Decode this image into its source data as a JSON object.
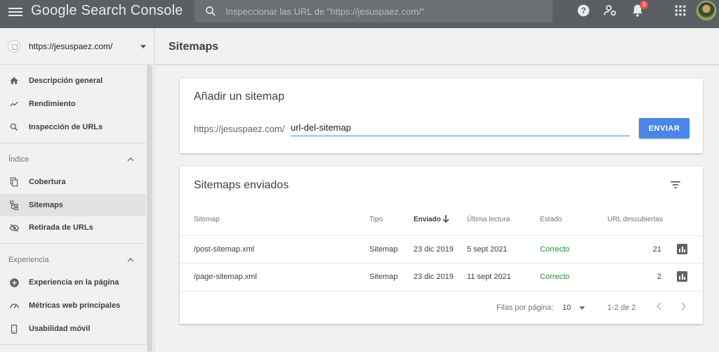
{
  "header": {
    "app_title": "Google Search Console",
    "search_placeholder": "Inspeccionar las URL de \"https://jesuspaez.com/\"",
    "notification_count": "3",
    "icons": [
      "menu-icon",
      "search-icon",
      "help-icon",
      "manage-users-icon",
      "bell-icon",
      "apps-grid-icon",
      "avatar"
    ]
  },
  "sidebar": {
    "property": "https://jesuspaez.com/",
    "nav_top": [
      {
        "label": "Descripción general",
        "icon": "home-icon"
      },
      {
        "label": "Rendimiento",
        "icon": "trending-up-icon"
      },
      {
        "label": "Inspección de URLs",
        "icon": "search-icon"
      }
    ],
    "section_index": {
      "title": "Índice",
      "items": [
        {
          "label": "Cobertura",
          "icon": "copy-pages-icon"
        },
        {
          "label": "Sitemaps",
          "icon": "sitemap-icon",
          "active": true
        },
        {
          "label": "Retirada de URLs",
          "icon": "eye-off-icon"
        }
      ]
    },
    "section_experience": {
      "title": "Experiencia",
      "items": [
        {
          "label": "Experiencia en la página",
          "icon": "plus-circle-icon"
        },
        {
          "label": "Métricas web principales",
          "icon": "speedometer-icon"
        },
        {
          "label": "Usabilidad móvil",
          "icon": "phone-icon"
        }
      ]
    }
  },
  "main": {
    "page_title": "Sitemaps",
    "add_card": {
      "title": "Añadir un sitemap",
      "url_prefix": "https://jesuspaez.com/",
      "input_value": "url-del-sitemap",
      "submit_label": "ENVIAR"
    },
    "list_card": {
      "title": "Sitemaps enviados",
      "columns": [
        "Sitemap",
        "Tipo",
        "Enviado",
        "Última lectura",
        "Estado",
        "URL descubiertas"
      ],
      "sorted_column": "Enviado",
      "rows": [
        {
          "sitemap": "/post-sitemap.xml",
          "tipo": "Sitemap",
          "enviado": "23 dic 2019",
          "ultima_lectura": "5 sept 2021",
          "estado": "Correcto",
          "url_descubiertas": "21"
        },
        {
          "sitemap": "/page-sitemap.xml",
          "tipo": "Sitemap",
          "enviado": "23 dic 2019",
          "ultima_lectura": "11 sept 2021",
          "estado": "Correcto",
          "url_descubiertas": "2"
        }
      ],
      "pagination": {
        "rows_label": "Filas por página:",
        "rows_value": "10",
        "range": "1-2 de 2"
      }
    }
  },
  "colors": {
    "header_bg": "#5a5f63",
    "accent_blue": "#4a86e8",
    "status_ok": "#1e8e3e",
    "badge_red": "#e5574a"
  }
}
